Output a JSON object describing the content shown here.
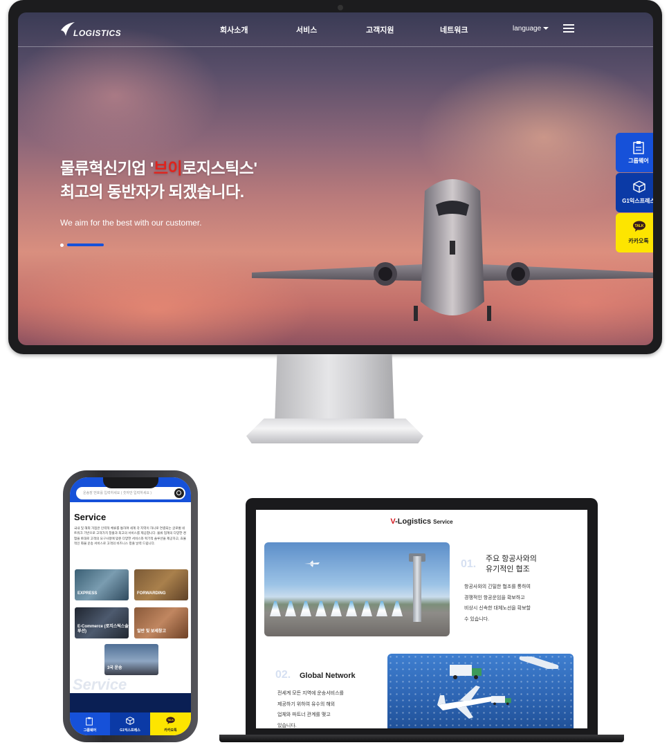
{
  "desktop": {
    "logo": {
      "text": "LOGISTICS"
    },
    "nav": [
      "회사소개",
      "서비스",
      "고객지원",
      "네트워크"
    ],
    "language_label": "language",
    "hero": {
      "title_line1_part1": "물류혁신기업 '",
      "title_line1_highlight": "브이",
      "title_line1_part2": "로지스틱스'",
      "title_line2": "최고의 동반자가 되겠습니다.",
      "subtitle": "We aim for the best with our customer.",
      "slide_count": 2,
      "active_slide": 2
    },
    "quick_menu": [
      {
        "label": "그룹웨어",
        "icon": "clipboard-icon"
      },
      {
        "label": "G1익스프레스",
        "icon": "package-icon"
      },
      {
        "label": "카카오톡",
        "icon": "kakaotalk-icon",
        "icon_text": "TALK"
      }
    ]
  },
  "mobile": {
    "search_placeholder": "운송장 번호를 입력하세요 ( 숫자만 입력하세요 )",
    "section_title": "Service",
    "section_desc": "국내 및 해외 거점은 인력적 체류를 통하여 세계 각 지역이 하나로 연결되는 글로벌 네트워크 기반으로 고객가치 창출과 최고의 서비스를 제공합니다. 물류 업계의 다양한 경험을 토대로 고객의 요구사항에 맞춘 다양한 서비스와 획기적 솔루션을 제공하고, 효율적인 화물 운송 서비스로 고객의 비즈니스 창출 날력 드립니다.",
    "cards": [
      {
        "label": "EXPRESS"
      },
      {
        "label": "FORWARDING"
      },
      {
        "label": "E-Commerce (로지스틱스솔루션)"
      },
      {
        "label": "일반 및 보세창고"
      },
      {
        "label": "3국 운송"
      }
    ],
    "watermark": "Service",
    "bottom_tabs": [
      {
        "label": "그룹웨어",
        "icon": "clipboard-icon"
      },
      {
        "label": "G1익스프레스",
        "icon": "package-icon"
      },
      {
        "label": "카카오톡",
        "icon": "kakaotalk-icon",
        "icon_text": "TALK"
      }
    ]
  },
  "laptop": {
    "heading_brand_prefix": "V",
    "heading_brand_rest": "-Logistics",
    "heading_suffix": "Service",
    "feature1": {
      "number": "01.",
      "title_line1": "주요 항공사와의",
      "title_line2": "유기적인 협조",
      "body": [
        "항공사와의 긴밀한 협조를 통하여",
        "경쟁적인 항공운임을 확보하고",
        "비상시 신속한 대체노선을 확보할",
        "수 있습니다."
      ]
    },
    "feature2": {
      "number": "02.",
      "title": "Global Network",
      "body": [
        "전세계 모든 지역에 운송서비스를",
        "제공하기 위하여 유수의 해외",
        "업체와 파트너 관계를 맺고",
        "있습니다."
      ]
    }
  },
  "colors": {
    "brand_blue": "#1651d9",
    "navy": "#0b3aa6",
    "kakao_yellow": "#fde500",
    "highlight_red": "#e0231c"
  }
}
